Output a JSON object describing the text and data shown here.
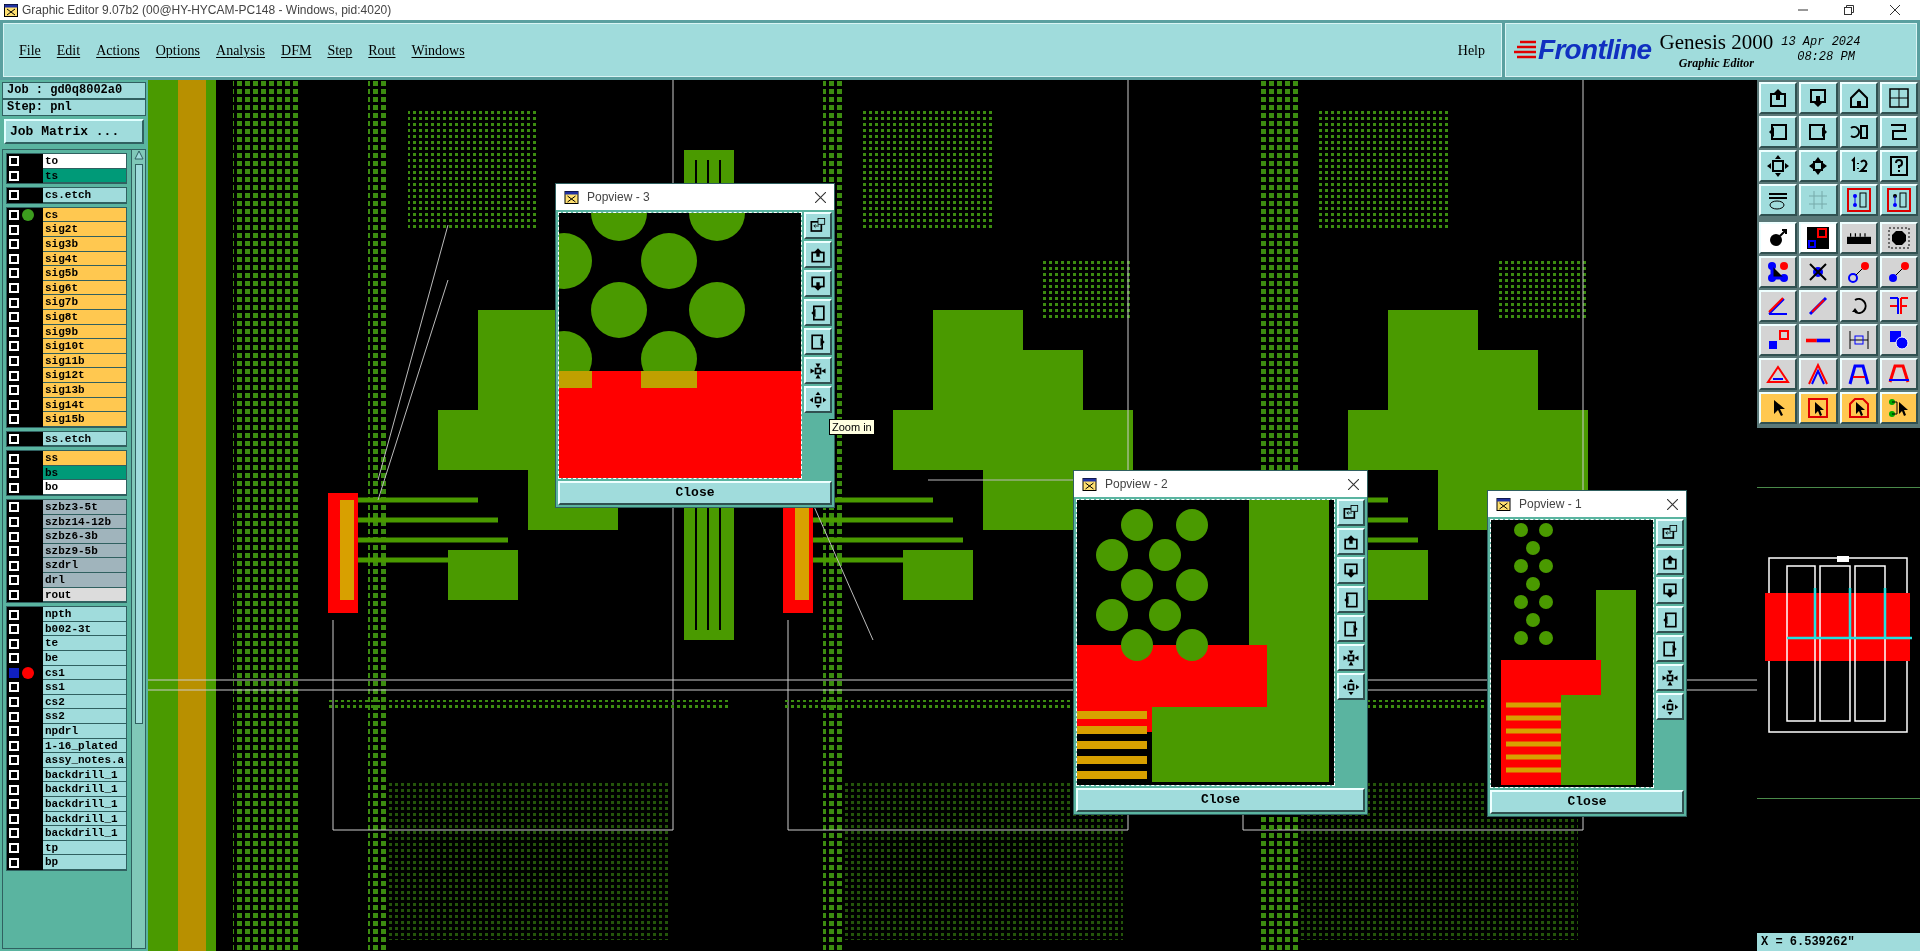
{
  "window": {
    "title": "Graphic Editor 9.07b2 (00@HY-HYCAM-PC148 - Windows, pid:4020)"
  },
  "menu": [
    "File",
    "Edit",
    "Actions",
    "Options",
    "Analysis",
    "DFM",
    "Step",
    "Rout",
    "Windows"
  ],
  "help": "Help",
  "brand": {
    "logo": "Frontline",
    "product": "Genesis 2000",
    "subtitle": "Graphic Editor",
    "date": "13 Apr 2024",
    "time": "08:28 PM"
  },
  "job": "Job : gd0q8002a0",
  "step": "Step: pnl",
  "job_matrix_button": "Job Matrix ...",
  "layer_groups": [
    {
      "layers": [
        {
          "name": "to",
          "color": "#ffffff",
          "work_layer": false,
          "highlighted": false,
          "affected": false
        },
        {
          "name": "ts",
          "color": "#009a78",
          "work_layer": false,
          "highlighted": false,
          "affected": false
        }
      ]
    },
    {
      "layers": [
        {
          "name": "cs.etch",
          "color": "#a0dcdc",
          "work_layer": false,
          "highlighted": false,
          "affected": false
        }
      ]
    },
    {
      "layers": [
        {
          "name": "cs",
          "color": "#ffc850",
          "work_layer": true,
          "highlighted": false,
          "affected": false
        },
        {
          "name": "sig2t",
          "color": "#ffc850",
          "work_layer": false,
          "highlighted": false,
          "affected": false
        },
        {
          "name": "sig3b",
          "color": "#ffc850",
          "work_layer": false,
          "highlighted": false,
          "affected": false
        },
        {
          "name": "sig4t",
          "color": "#ffc850",
          "work_layer": false,
          "highlighted": false,
          "affected": false
        },
        {
          "name": "sig5b",
          "color": "#ffc850",
          "work_layer": false,
          "highlighted": false,
          "affected": false
        },
        {
          "name": "sig6t",
          "color": "#ffc850",
          "work_layer": false,
          "highlighted": false,
          "affected": false
        },
        {
          "name": "sig7b",
          "color": "#ffc850",
          "work_layer": false,
          "highlighted": false,
          "affected": false
        },
        {
          "name": "sig8t",
          "color": "#ffc850",
          "work_layer": false,
          "highlighted": false,
          "affected": false
        },
        {
          "name": "sig9b",
          "color": "#ffc850",
          "work_layer": false,
          "highlighted": false,
          "affected": false
        },
        {
          "name": "sig10t",
          "color": "#ffc850",
          "work_layer": false,
          "highlighted": false,
          "affected": false
        },
        {
          "name": "sig11b",
          "color": "#ffc850",
          "work_layer": false,
          "highlighted": false,
          "affected": false
        },
        {
          "name": "sig12t",
          "color": "#ffc850",
          "work_layer": false,
          "highlighted": false,
          "affected": false
        },
        {
          "name": "sig13b",
          "color": "#ffc850",
          "work_layer": false,
          "highlighted": false,
          "affected": false
        },
        {
          "name": "sig14t",
          "color": "#ffc850",
          "work_layer": false,
          "highlighted": false,
          "affected": false
        },
        {
          "name": "sig15b",
          "color": "#ffc850",
          "work_layer": false,
          "highlighted": false,
          "affected": false
        }
      ]
    },
    {
      "layers": [
        {
          "name": "ss.etch",
          "color": "#a0dcdc",
          "work_layer": false,
          "highlighted": false,
          "affected": false
        }
      ]
    },
    {
      "layers": [
        {
          "name": "ss",
          "color": "#ffc850",
          "work_layer": false,
          "highlighted": false,
          "affected": false
        },
        {
          "name": "bs",
          "color": "#009a78",
          "work_layer": false,
          "highlighted": false,
          "affected": false
        },
        {
          "name": "bo",
          "color": "#ffffff",
          "work_layer": false,
          "highlighted": false,
          "affected": false
        }
      ]
    },
    {
      "layers": [
        {
          "name": "szbz3-5t",
          "color": "#a0b4bc",
          "work_layer": false,
          "highlighted": false,
          "affected": false
        },
        {
          "name": "szbz14-12b",
          "color": "#a0b4bc",
          "work_layer": false,
          "highlighted": false,
          "affected": false
        },
        {
          "name": "szbz6-3b",
          "color": "#a0b4bc",
          "work_layer": false,
          "highlighted": false,
          "affected": false
        },
        {
          "name": "szbz9-5b",
          "color": "#a0b4bc",
          "work_layer": false,
          "highlighted": false,
          "affected": false
        },
        {
          "name": "szdrl",
          "color": "#a0b4bc",
          "work_layer": false,
          "highlighted": false,
          "affected": false
        },
        {
          "name": "drl",
          "color": "#a0b4bc",
          "work_layer": false,
          "highlighted": false,
          "affected": false
        },
        {
          "name": "rout",
          "color": "#dcdcdc",
          "work_layer": false,
          "highlighted": false,
          "affected": false
        }
      ]
    },
    {
      "layers": [
        {
          "name": "npth",
          "color": "#a0dcdc",
          "work_layer": false,
          "highlighted": false,
          "affected": false
        },
        {
          "name": "b002-3t",
          "color": "#a0dcdc",
          "work_layer": false,
          "highlighted": false,
          "affected": false
        },
        {
          "name": "te",
          "color": "#a0dcdc",
          "work_layer": false,
          "highlighted": false,
          "affected": false
        },
        {
          "name": "be",
          "color": "#a0dcdc",
          "work_layer": false,
          "highlighted": false,
          "affected": false
        },
        {
          "name": "cs1",
          "color": "#a0dcdc",
          "work_layer": false,
          "highlighted": true,
          "affected": true
        },
        {
          "name": "ss1",
          "color": "#a0dcdc",
          "work_layer": false,
          "highlighted": false,
          "affected": false
        },
        {
          "name": "cs2",
          "color": "#a0dcdc",
          "work_layer": false,
          "highlighted": false,
          "affected": false
        },
        {
          "name": "ss2",
          "color": "#a0dcdc",
          "work_layer": false,
          "highlighted": false,
          "affected": false
        },
        {
          "name": "npdrl",
          "color": "#a0dcdc",
          "work_layer": false,
          "highlighted": false,
          "affected": false
        },
        {
          "name": "1-16_plated",
          "color": "#a0dcdc",
          "work_layer": false,
          "highlighted": false,
          "affected": false
        },
        {
          "name": "assy_notes.a",
          "color": "#a0dcdc",
          "work_layer": false,
          "highlighted": false,
          "affected": false
        },
        {
          "name": "backdrill_1",
          "color": "#a0dcdc",
          "work_layer": false,
          "highlighted": false,
          "affected": false
        },
        {
          "name": "backdrill_1",
          "color": "#a0dcdc",
          "work_layer": false,
          "highlighted": false,
          "affected": false
        },
        {
          "name": "backdrill_1",
          "color": "#a0dcdc",
          "work_layer": false,
          "highlighted": false,
          "affected": false
        },
        {
          "name": "backdrill_1",
          "color": "#a0dcdc",
          "work_layer": false,
          "highlighted": false,
          "affected": false
        },
        {
          "name": "backdrill_1",
          "color": "#a0dcdc",
          "work_layer": false,
          "highlighted": false,
          "affected": false
        },
        {
          "name": "tp",
          "color": "#a0dcdc",
          "work_layer": false,
          "highlighted": false,
          "affected": false
        },
        {
          "name": "bp",
          "color": "#a0dcdc",
          "work_layer": false,
          "highlighted": false,
          "affected": false
        }
      ]
    }
  ],
  "popviews": [
    {
      "title": "Popview - 3",
      "close_label": "Close"
    },
    {
      "title": "Popview - 2",
      "close_label": "Close"
    },
    {
      "title": "Popview - 1",
      "close_label": "Close"
    }
  ],
  "tooltip": "Zoom in",
  "coordinates": "X = 6.539262\""
}
